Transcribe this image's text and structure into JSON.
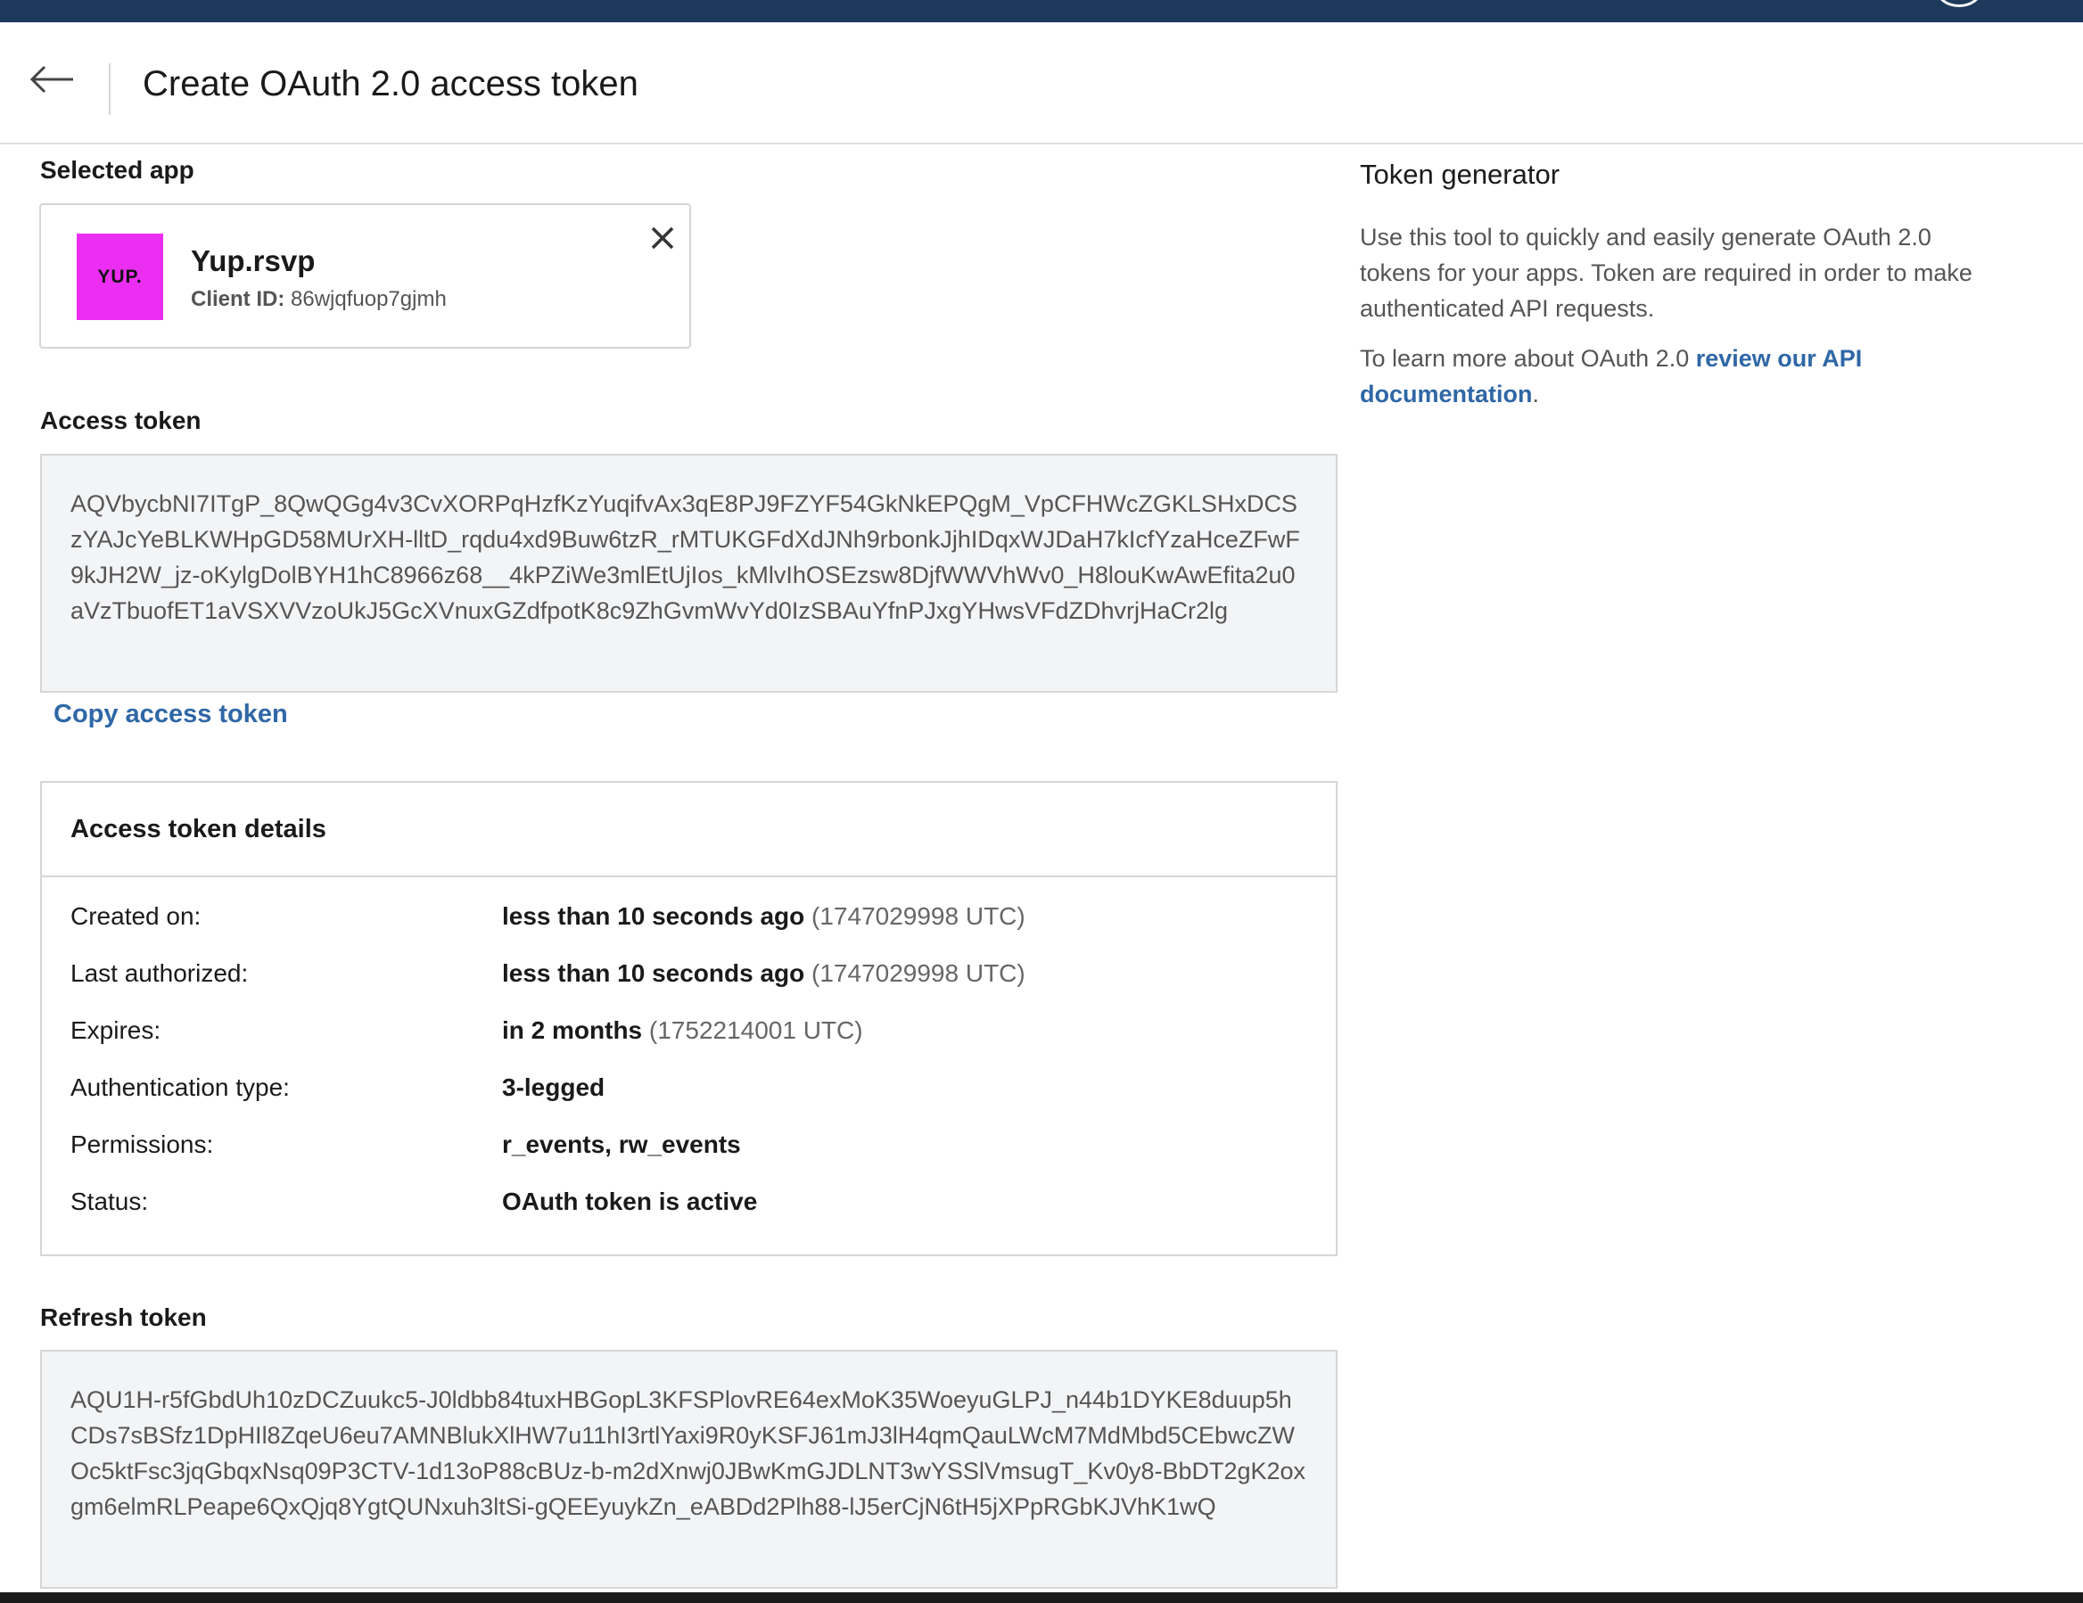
{
  "header": {
    "title": "Create OAuth 2.0 access token"
  },
  "selected_app": {
    "label": "Selected app",
    "logo_text": "YUP.",
    "name": "Yup.rsvp",
    "client_id_label": "Client ID:",
    "client_id": "86wjqfuop7gjmh"
  },
  "access_token": {
    "label": "Access token",
    "value": "AQVbycbNI7ITgP_8QwQGg4v3CvXORPqHzfKzYuqifvAx3qE8PJ9FZYF54GkNkEPQgM_VpCFHWcZGKLSHxDCSzYAJcYeBLKWHpGD58MUrXH-lltD_rqdu4xd9Buw6tzR_rMTUKGFdXdJNh9rbonkJjhIDqxWJDaH7kIcfYzaHceZFwF9kJH2W_jz-oKylgDolBYH1hC8966z68__4kPZiWe3mlEtUjIos_kMlvIhOSEzsw8DjfWWVhWv0_H8louKwAwEfita2u0aVzTbuofET1aVSXVVzoUkJ5GcXVnuxGZdfpotK8c9ZhGvmWvYd0IzSBAuYfnPJxgYHwsVFdZDhvrjHaCr2lg",
    "copy_label": "Copy access token"
  },
  "details": {
    "title": "Access token details",
    "rows": [
      {
        "label": "Created on:",
        "value": "less than 10 seconds ago",
        "extra": "(1747029998 UTC)"
      },
      {
        "label": "Last authorized:",
        "value": "less than 10 seconds ago",
        "extra": "(1747029998 UTC)"
      },
      {
        "label": "Expires:",
        "value": "in 2 months",
        "extra": "(1752214001 UTC)"
      },
      {
        "label": "Authentication type:",
        "value": "3-legged",
        "extra": ""
      },
      {
        "label": "Permissions:",
        "value": "r_events, rw_events",
        "extra": ""
      },
      {
        "label": "Status:",
        "value": "OAuth token is active",
        "extra": ""
      }
    ]
  },
  "refresh_token": {
    "label": "Refresh token",
    "value": "AQU1H-r5fGbdUh10zDCZuukc5-J0ldbb84tuxHBGopL3KFSPlovRE64exMoK35WoeyuGLPJ_n44b1DYKE8duup5hCDs7sBSfz1DpHIl8ZqeU6eu7AMNBlukXlHW7u11hI3rtlYaxi9R0yKSFJ61mJ3lH4qmQauLWcM7MdMbd5CEbwcZWOc5ktFsc3jqGbqxNsq09P3CTV-1d13oP88cBUz-b-m2dXnwj0JBwKmGJDLNT3wYSSlVmsugT_Kv0y8-BbDT2gK2oxgm6elmRLPeape6QxQjq8YgtQUNxuh3ltSi-gQEEyuykZn_eABDd2Plh88-lJ5erCjN6tH5jXPpRGbKJVhK1wQ"
  },
  "sidebar": {
    "title": "Token generator",
    "description": "Use this tool to quickly and easily generate OAuth 2.0 tokens for your apps. Token are required in order to make authenticated API requests.",
    "learn_prefix": "To learn more about OAuth 2.0 ",
    "learn_link": "review our API documentation",
    "learn_suffix": "."
  },
  "colors": {
    "top_bar": "#1d3a5c",
    "link": "#2f67a6",
    "app_logo": "#ec2ef2"
  },
  "icons": {
    "back": "arrow-left-icon",
    "close": "close-icon"
  }
}
